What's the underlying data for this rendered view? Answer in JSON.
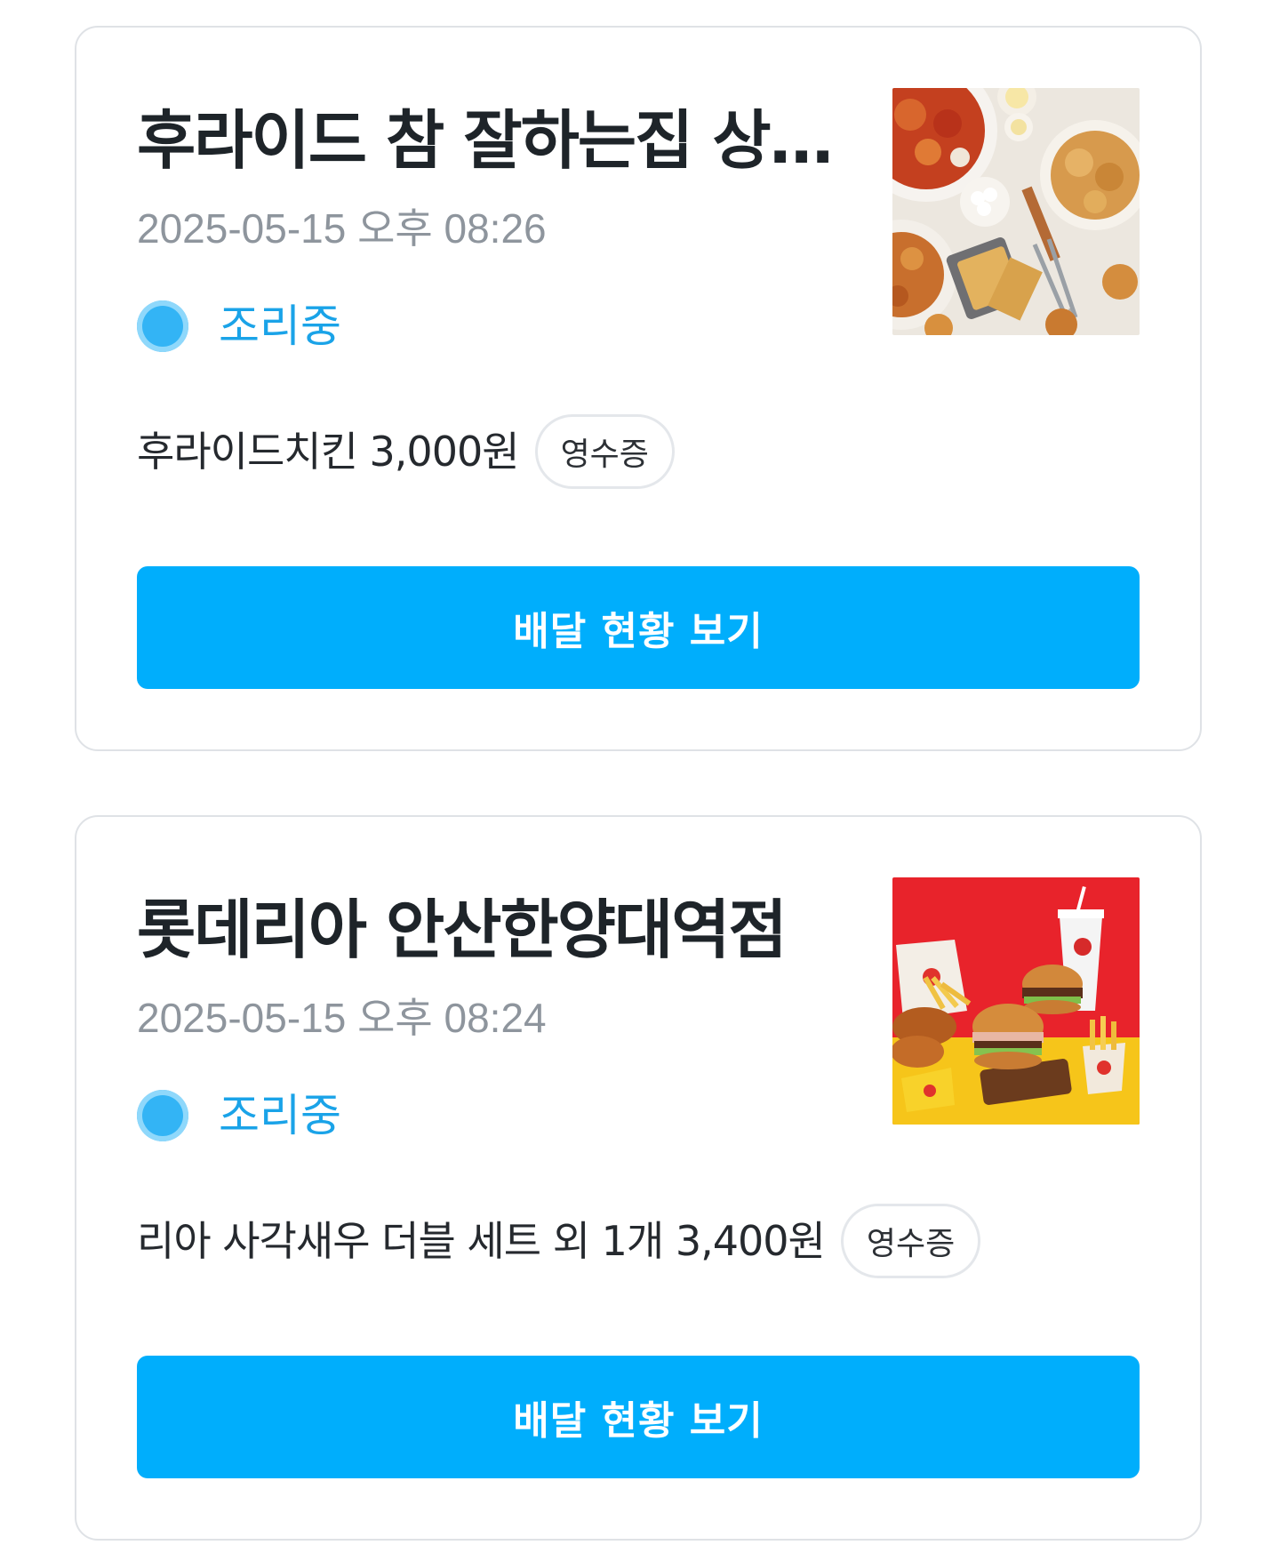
{
  "orders": [
    {
      "store_name": "후라이드 참 잘하는집 상…",
      "date": "2025-05-15 오후 08:26",
      "status": "조리중",
      "menu_summary": "후라이드치킨 3,000원",
      "receipt_label": "영수증",
      "track_label": "배달 현황 보기"
    },
    {
      "store_name": "롯데리아 안산한양대역점",
      "date": "2025-05-15 오후 08:24",
      "status": "조리중",
      "menu_summary": "리아 사각새우 더블 세트 외 1개 3,400원",
      "receipt_label": "영수증",
      "track_label": "배달 현황 보기"
    }
  ],
  "colors": {
    "accent": "#00aefc",
    "status": "#1aa3e8",
    "border": "#dfe2e6",
    "date": "#8e959d"
  }
}
